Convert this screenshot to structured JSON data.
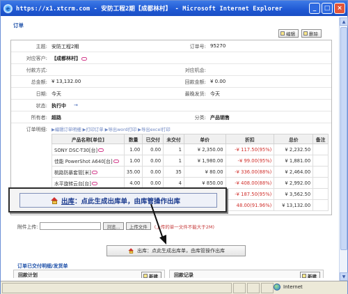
{
  "window": {
    "title": "https://x1.xtcrm.com - 安防工程2期【成都林村】 - Microsoft Internet Explorer",
    "minimize": "_",
    "maximize": "□",
    "close": "×"
  },
  "page": {
    "section_title": "订单",
    "edit_label": "编辑",
    "delete_label": "删除"
  },
  "fields": {
    "subject_label": "主题:",
    "subject_value": "安防工程2期",
    "order_no_label": "订单号:",
    "order_no_value": "95270",
    "customer_label": "对应客户:",
    "customer_value": "【成都林村】",
    "payment_label": "付款方式:",
    "opportunity_label": "对应机会:",
    "total_label": "总金额:",
    "total_value": "¥ 13,132.00",
    "received_label": "回款金额:",
    "received_value": "¥ 0.00",
    "date_label": "日期:",
    "date_value": "今天",
    "ship_label": "最晚发货:",
    "ship_value": "今天",
    "status_label": "状态:",
    "status_value": "执行中",
    "owner_label": "所有者:",
    "owner_value": "超路",
    "category_label": "分类:",
    "category_value": "产品销售",
    "detail_label": "订单明细:",
    "detail_links": "▶编辑订单明细  ▶打印订单  ▶导出word打印  ▶导出excel打印"
  },
  "items_table": {
    "headers": [
      "产品名称[单位]",
      "数量",
      "已交付",
      "未交付",
      "单价",
      "折扣",
      "总价",
      "备注"
    ],
    "rows": [
      {
        "name": "SONY DSC-T30[台]",
        "qty": "1.00",
        "delivered": "0.00",
        "undelivered": "1",
        "price": "¥ 2,350.00",
        "discount": "-¥ 117.50(95%)",
        "total": "¥ 2,232.50"
      },
      {
        "name": "佳能 PowerShot A640[台]",
        "qty": "1.00",
        "delivered": "0.00",
        "undelivered": "1",
        "price": "¥ 1,980.00",
        "discount": "-¥ 99.00(95%)",
        "total": "¥ 1,881.00"
      },
      {
        "name": "桃路防暴套管[米]",
        "qty": "35.00",
        "delivered": "0.00",
        "undelivered": "35",
        "price": "¥ 80.00",
        "discount": "-¥ 336.00(88%)",
        "total": "¥ 2,464.00"
      },
      {
        "name": "水平旋转云台[台]",
        "qty": "4.00",
        "delivered": "0.00",
        "undelivered": "4",
        "price": "¥ 850.00",
        "discount": "-¥ 408.00(88%)",
        "total": "¥ 2,992.00"
      },
      {
        "name": "",
        "qty": "",
        "delivered": "",
        "undelivered": "",
        "price": "",
        "discount": "-¥ 187.50(95%)",
        "total": "¥ 3,562.50"
      },
      {
        "name": "",
        "qty": "",
        "delivered": "",
        "undelivered": "",
        "price": "",
        "discount": "48.00(91.96%)",
        "total": "¥ 13,132.00"
      }
    ]
  },
  "callout": {
    "bold_text": "出库",
    "rest_text": "：点此生成出库单，由库管操作出库"
  },
  "upload": {
    "label": "附件上传:",
    "browse": "浏览...",
    "upload": "上传文件",
    "hint": "(上传的单一文件不能大于2M)"
  },
  "out_button": {
    "text": "出库：点此生成出库单，由库管操作出库"
  },
  "delivery": {
    "title": "订单已交付明细/发货单",
    "plan_label": "回款计划",
    "record_label": "回款记录",
    "new_label": "新建"
  },
  "statusbar": {
    "zone": "Internet"
  }
}
